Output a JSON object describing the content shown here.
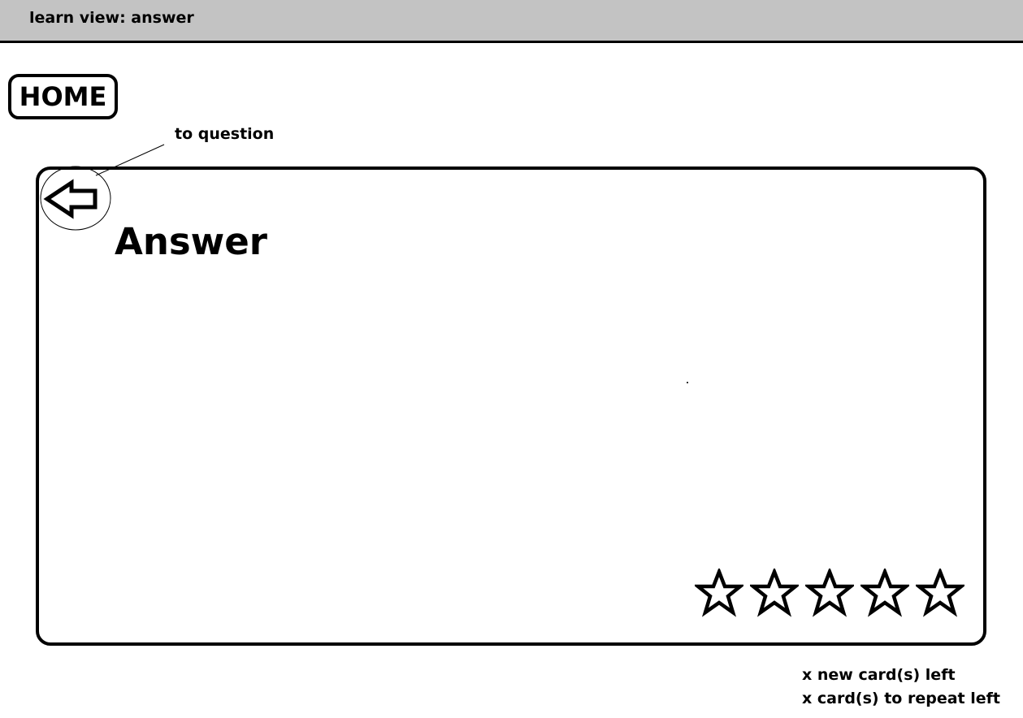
{
  "window": {
    "title": "learn view: answer"
  },
  "nav": {
    "home_label": "HOME"
  },
  "annotation": {
    "back_hint": "to question"
  },
  "card": {
    "title": "Answer",
    "back_icon": "arrow-left-icon",
    "rating": {
      "max": 5,
      "filled": 0,
      "star_icon": "star-outline-icon"
    }
  },
  "status": {
    "new_cards": "x new card(s) left",
    "repeat_cards": "x card(s) to repeat left"
  }
}
